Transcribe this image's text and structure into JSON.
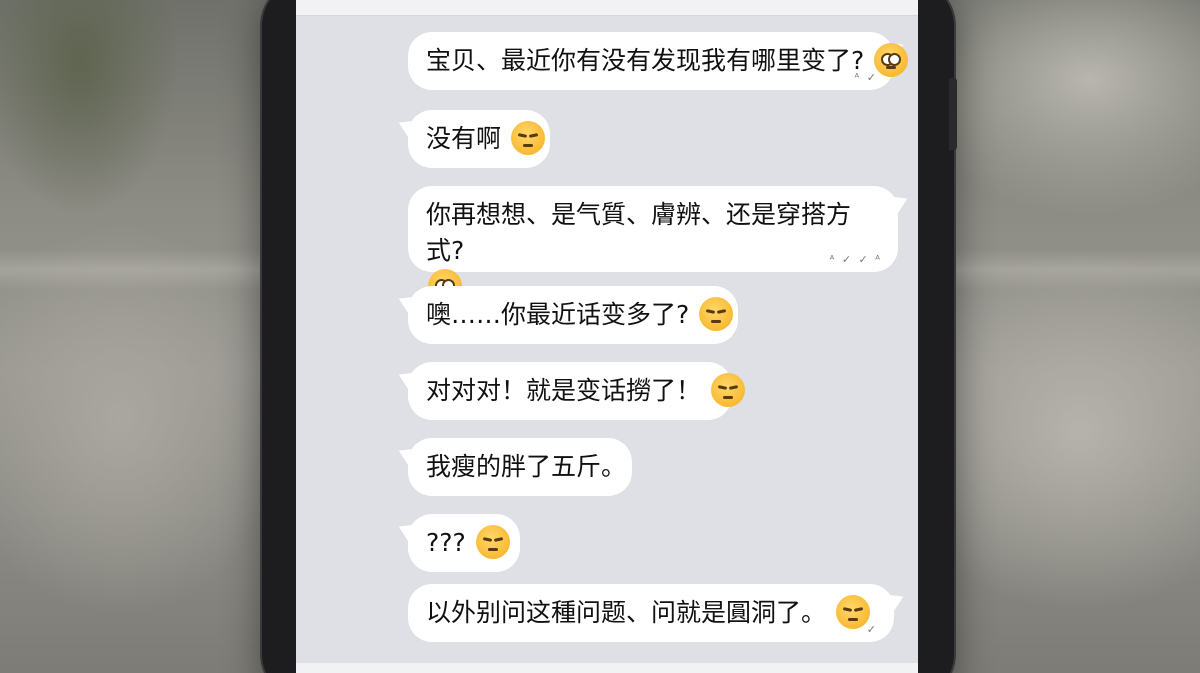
{
  "messages": [
    {
      "side": "out",
      "text": "宝贝、最近你有没有发现我有哪里变了?",
      "emoji": "teary-face-emoji-icon",
      "meta": "ᴬ ✓"
    },
    {
      "side": "in",
      "text": "没有啊",
      "emoji": "pensive-face-emoji-icon",
      "meta": ""
    },
    {
      "side": "out",
      "text": "你再想想、是气質、膚辨、还是穿搭方式?",
      "emoji": "teary-face-emoji-icon",
      "meta": "ᴬ ✓ ✓ ᴬ"
    },
    {
      "side": "in",
      "text": "噢……你最近话变多了?",
      "emoji": "pensive-face-emoji-icon",
      "meta": ""
    },
    {
      "side": "in",
      "text": "对对对！就是变话撈了！",
      "emoji": "pensive-face-emoji-icon",
      "meta": ""
    },
    {
      "side": "in",
      "text": "我瘦的胖了五斤。",
      "emoji": "",
      "meta": ""
    },
    {
      "side": "in",
      "text": "???",
      "emoji": "expressionless-face-emoji-icon",
      "meta": ""
    },
    {
      "side": "out",
      "text": "以外别问这種问题、问就是圓洞了。",
      "emoji": "pensive-face-emoji-icon",
      "meta": "✓"
    }
  ],
  "colors": {
    "bubble": "#ffffff",
    "screen_bg": "#dfe0e6",
    "text": "#111111"
  }
}
